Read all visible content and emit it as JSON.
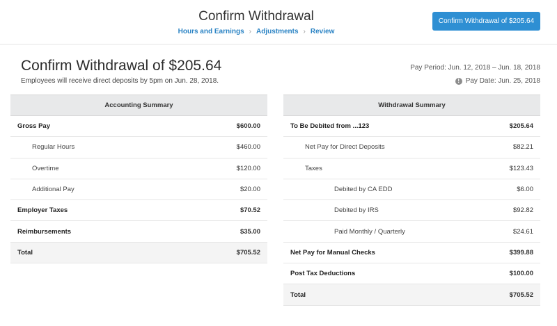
{
  "header": {
    "title": "Confirm Withdrawal",
    "steps": [
      "Hours and Earnings",
      "Adjustments",
      "Review"
    ],
    "confirm_button": "Confirm Withdrawal of $205.64"
  },
  "main": {
    "title": "Confirm Withdrawal of $205.64",
    "subtitle": "Employees will receive direct deposits by 5pm on Jun. 28, 2018.",
    "pay_period": "Pay Period: Jun. 12, 2018 – Jun. 18, 2018",
    "pay_date": "Pay Date: Jun. 25, 2018",
    "info_icon": "info-icon"
  },
  "accounting": {
    "header": "Accounting Summary",
    "rows": [
      {
        "label": "Gross Pay",
        "value": "$600.00"
      },
      {
        "label": "Regular Hours",
        "value": "$460.00"
      },
      {
        "label": "Overtime",
        "value": "$120.00"
      },
      {
        "label": "Additional Pay",
        "value": "$20.00"
      },
      {
        "label": "Employer Taxes",
        "value": "$70.52"
      },
      {
        "label": "Reimbursements",
        "value": "$35.00"
      },
      {
        "label": "Total",
        "value": "$705.52"
      }
    ]
  },
  "withdrawal": {
    "header": "Withdrawal Summary",
    "rows": [
      {
        "label": "To Be Debited from ...123",
        "value": "$205.64"
      },
      {
        "label": "Net Pay for Direct Deposits",
        "value": "$82.21"
      },
      {
        "label": "Taxes",
        "value": "$123.43"
      },
      {
        "label": "Debited by CA EDD",
        "value": "$6.00"
      },
      {
        "label": "Debited by IRS",
        "value": "$92.82"
      },
      {
        "label": "Paid Monthly / Quarterly",
        "value": "$24.61"
      },
      {
        "label": "Net Pay for Manual Checks",
        "value": "$399.88"
      },
      {
        "label": "Post Tax Deductions",
        "value": "$100.00"
      },
      {
        "label": "Total",
        "value": "$705.52"
      }
    ]
  }
}
